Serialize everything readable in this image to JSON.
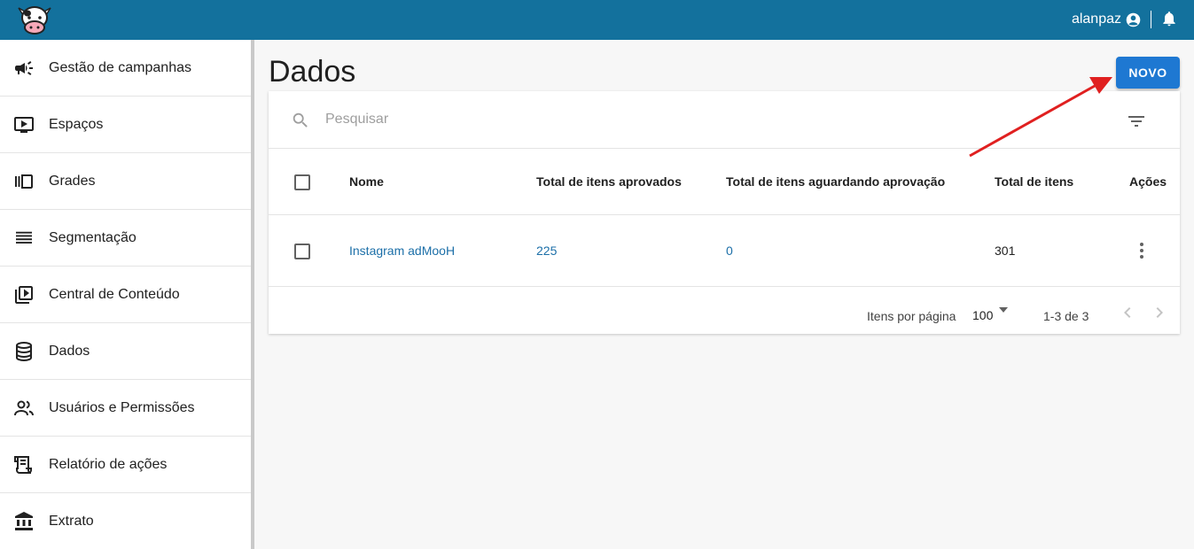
{
  "header": {
    "username": "alanpaz",
    "logo_icon": "cow-logo-icon",
    "user_icon": "account-circle-icon",
    "bell_icon": "bell-icon",
    "color": "#13719d"
  },
  "sidebar": {
    "items": [
      {
        "label": "Gestão de campanhas",
        "icon": "megaphone-icon"
      },
      {
        "label": "Espaços",
        "icon": "screen-play-icon"
      },
      {
        "label": "Grades",
        "icon": "carousel-icon"
      },
      {
        "label": "Segmentação",
        "icon": "lines-icon"
      },
      {
        "label": "Central de Conteúdo",
        "icon": "video-library-icon"
      },
      {
        "label": "Dados",
        "icon": "database-icon"
      },
      {
        "label": "Usuários e Permissões",
        "icon": "people-icon"
      },
      {
        "label": "Relatório de ações",
        "icon": "receipt-icon"
      },
      {
        "label": "Extrato",
        "icon": "bank-icon"
      }
    ]
  },
  "main": {
    "title": "Dados",
    "new_button": "NOVO",
    "accent": "#1e78d2",
    "search_placeholder": "Pesquisar",
    "table": {
      "columns": [
        "Nome",
        "Total de itens aprovados",
        "Total de itens aguardando aprovação",
        "Total de itens",
        "Ações"
      ],
      "rows": [
        {
          "nome": "Instagram adMooH",
          "aprovados": "225",
          "aguardando": "0",
          "total": "301"
        }
      ]
    },
    "pagination": {
      "label": "Itens por página",
      "per_page": "100",
      "range": "1-3 de 3"
    }
  }
}
